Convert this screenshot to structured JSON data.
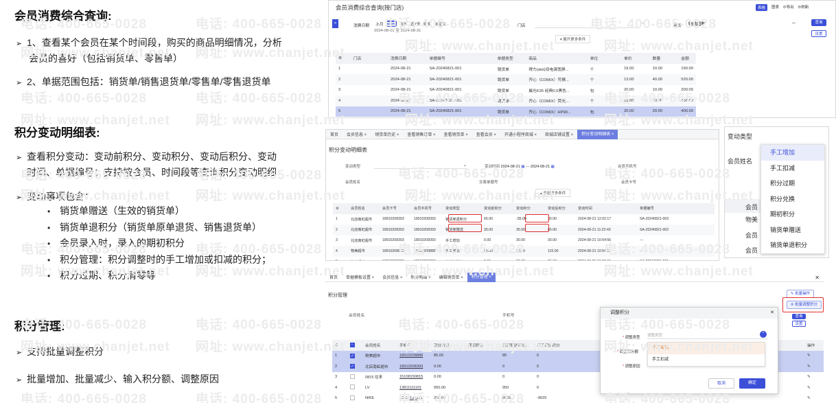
{
  "left": {
    "h_member": "会员消费综合查询:",
    "member_b1": "1、查看某个会员在某个时间段，购买的商品明细情况，分析会员的喜好（包括销货单、零售单）",
    "member_b1_l1": "1、查看某个会员在某个时间段，购买的商品明细情况，分析",
    "member_b1_l2": "会员的喜好（包括销货单、零售单）",
    "member_b2": "2、单据范围包括：销货单/销售退货单/零售单/零售退货单",
    "h_points": "积分变动明细表:",
    "points_b1_l1": "查看积分变动：变动前积分、变动积分、变动后积分、变动",
    "points_b1_l2": "时间、单据编号；支持按会员、时间段等查询积分变动明细",
    "points_b2": "变动事项包含：",
    "points_sub": [
      "销货单赠送（生效的销货单）",
      "销货单退积分（销货单原单退货、销售退货单）",
      "会员录入时，录入的期初积分",
      "积分管理：积分调整时的手工增加或扣减的积分；",
      "积分过期、积分清零等"
    ],
    "h_manage": "积分管理:",
    "manage_b1": "支持批量调整积分",
    "manage_b2": "批量增加、批量减少、输入积分额、调整原因"
  },
  "watermark": {
    "phone": "电话: 400-665-0028",
    "site": "网址: www.chanjet.net"
  },
  "p1": {
    "title": "会员消费综合查询(按门店)",
    "top_right": [
      "表格",
      "图表",
      "导出",
      "刷新"
    ],
    "date_label": "消费日期",
    "date_opts": [
      "上月",
      "本月",
      "本周",
      "近7天",
      "更多",
      "自定义"
    ],
    "date_range": "2024-08-01 至 2024-08-31",
    "store_label": "门店",
    "member_label": "会员",
    "member_value": "物美超市",
    "query": "查询",
    "settings": "设置",
    "expand": "展开更多条件",
    "headers": [
      "",
      "门店",
      "消费日期",
      "单据编号",
      "单据类型",
      "商品",
      "单位",
      "单价",
      "数量",
      "金额"
    ],
    "rows": [
      [
        "1",
        "",
        "2024-08-21",
        "SA-20240821-001",
        "销货单",
        "得力(deli)双电源宽屏...",
        "个",
        "19.00",
        "10.00",
        "190.00"
      ],
      [
        "2",
        "",
        "2024-08-21",
        "SA-20240821-001",
        "销货单",
        "齐心（COMIX）可擦...",
        "个",
        "13.00",
        "40.00",
        "520.00"
      ],
      [
        "3",
        "",
        "2024-08-21",
        "SA-20240821-001",
        "销货单",
        "晨光K35 经典0.5黑色...",
        "包",
        "20.00",
        "10.00",
        "200.00"
      ],
      [
        "4",
        "",
        "2024-08-21",
        "SA-20240821-001",
        "销货单",
        "齐心（COMIX）荧光...",
        "个",
        "15.00",
        "30.00",
        "450.00"
      ],
      [
        "5",
        "",
        "2024-08-21",
        "SA-20240821-001",
        "销货单",
        "齐心（COMIX）HP90...",
        "包",
        "20.00",
        "20.00",
        "400.00"
      ]
    ]
  },
  "p2": {
    "tabs": [
      "首页",
      "会员信息 ×",
      "销货单历史 ×",
      "查看销售订单 ×",
      "查看销货单 ×",
      "查看会员 ×",
      "开通小程序商城 ×",
      "商城店铺设置 ×",
      "积分变动明细表 ×"
    ],
    "title": "积分变动明细表",
    "f_type": "变动类型",
    "f_time": "变动时间",
    "f_from": "2024-08-21",
    "f_to": "2024-08-21",
    "f_phone": "会员手机号",
    "f_name": "会员姓名",
    "f_bill": "交易单据号",
    "f_card": "会员卡号",
    "collapse": "收起更多条件",
    "headers": [
      "",
      "会员姓名",
      "会员卡号",
      "会员手机号",
      "变动类型",
      "变动前积分",
      "变动积分",
      "变动后积分",
      "变动时间",
      "单据编号"
    ],
    "rows": [
      [
        "1",
        "北店南虹超市",
        "18910208393",
        "18910208393",
        "销货单退积分",
        "65.00",
        "-35.00",
        "30.00",
        "2024-08-21 12:02:17",
        "SA-20240821-003"
      ],
      [
        "2",
        "北店南虹超市",
        "18910208393",
        "18910208393",
        "销货单赠送",
        "30.00",
        "35.00",
        "65.00",
        "2024-08-21 11:22:43",
        "SA-20240821-002"
      ],
      [
        "3",
        "北店南虹超市",
        "18910208393",
        "18910208393",
        "手工增加",
        "0.00",
        "30.00",
        "30.00",
        "2024-08-21 10:54:56",
        "---"
      ],
      [
        "4",
        "物美超市",
        "18910208888",
        "18910208888",
        "手工增加",
        "85.00",
        "30.00",
        "115.00",
        "2024-08-21 10:54:56",
        "---"
      ],
      [
        "5",
        "物美超市",
        "18910208888",
        "18910208888",
        "销货单赠送",
        "0.00",
        "85.00",
        "85.00",
        "2024-08-21 10:20:06",
        "SA-20240821-001"
      ]
    ]
  },
  "p3": {
    "label_type": "变动类型",
    "label_name": "会员姓名",
    "options": [
      "手工增加",
      "手工扣减",
      "积分过期",
      "积分兑换",
      "期初积分",
      "销货单赠送",
      "销货单退积分"
    ],
    "col_member": "会员",
    "names": [
      "物美",
      "会员",
      "会员"
    ]
  },
  "p4": {
    "tabs": [
      "首页",
      "单据模板设置 ×",
      "会员信息 ×",
      "积分明细 ×",
      "编辑销货单 ×",
      "积分管理 ×"
    ],
    "title": "积分管理",
    "f_name": "会员姓名",
    "f_phone": "手机号",
    "btn_batch": "批量操作",
    "btn_adjust": "批量调整积分",
    "btn_query": "查询",
    "btn_settings": "设置",
    "headers": [
      "",
      "",
      "会员姓名",
      "手机号",
      "积分余额",
      "期初积分",
      "消费赠送积分...",
      "手工增加积分",
      "",
      "操作"
    ],
    "rows": [
      {
        "n": "1",
        "chk": true,
        "name": "物美超市",
        "phone": "18910208888",
        "bal": "85.00",
        "init": "",
        "gift": "85",
        "manual": "0"
      },
      {
        "n": "2",
        "chk": true,
        "name": "北店南虹超市",
        "phone": "18910208393",
        "bal": "0.00",
        "init": "",
        "gift": "0",
        "manual": "0"
      },
      {
        "n": "3",
        "chk": false,
        "name": "0815 往来",
        "phone": "15108150815",
        "bal": "0.00",
        "init": "",
        "gift": "0",
        "manual": "0"
      },
      {
        "n": "4",
        "chk": false,
        "name": "LV",
        "phone": "13811111101",
        "bal": "950.00",
        "init": "",
        "gift": "950",
        "manual": "0"
      },
      {
        "n": "5",
        "chk": false,
        "name": "NIKE",
        "phone": "13110191231",
        "bal": "280.00",
        "init": "",
        "gift": "9905",
        "manual": "-9625"
      }
    ],
    "dialog": {
      "title": "调整积分",
      "type_label": "调整类型",
      "type_placeholder": "调整类型",
      "points_label": "调整积分额",
      "reason_label": "调整原因",
      "options": [
        "手工增加",
        "手工扣减"
      ],
      "cancel": "取消",
      "ok": "确定"
    }
  },
  "colors": {
    "accent": "#3b4fd8",
    "selected_row": "#c7cff2",
    "red": "#e03030"
  }
}
